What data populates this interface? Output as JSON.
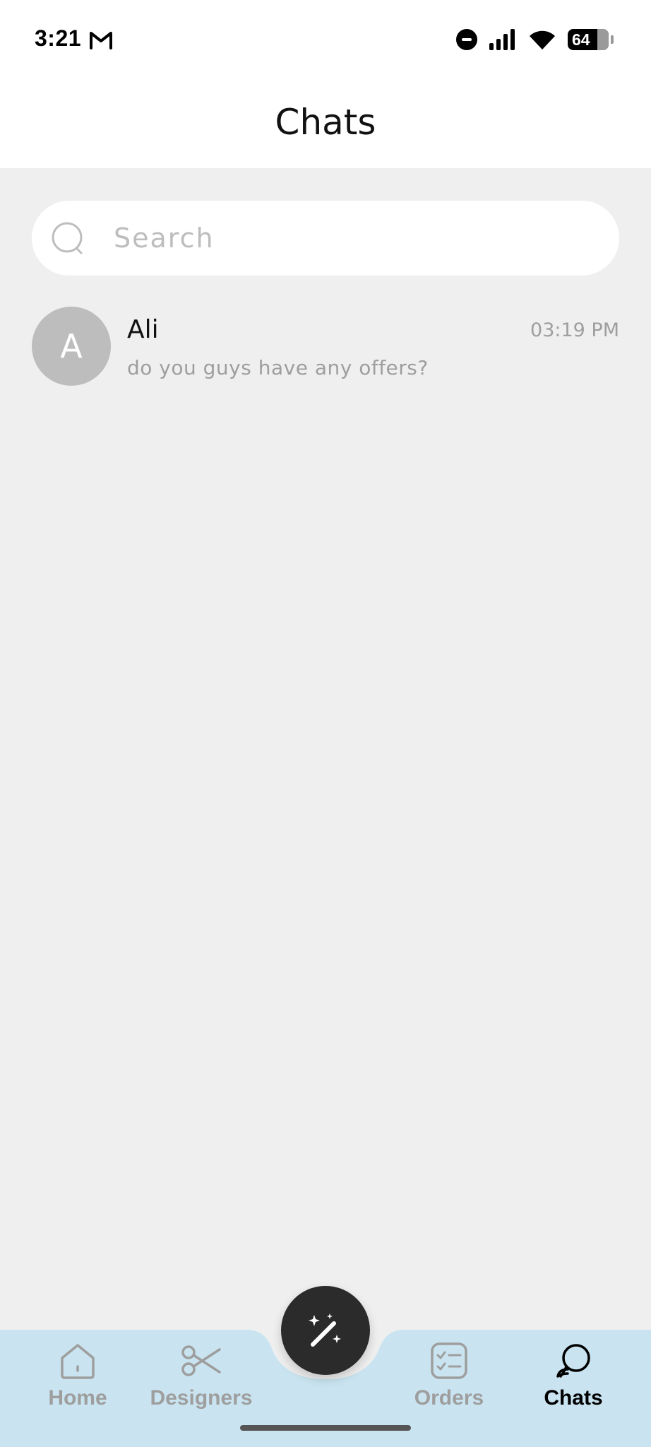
{
  "status_bar": {
    "time": "3:21",
    "battery_level": "64",
    "notification_icon": "gmail-icon",
    "indicators": [
      "do-not-disturb-icon",
      "signal-icon",
      "wifi-icon",
      "battery-icon"
    ]
  },
  "header": {
    "title": "Chats"
  },
  "search": {
    "placeholder": "Search",
    "value": ""
  },
  "chats": [
    {
      "avatar_letter": "A",
      "name": "Ali",
      "time": "03:19 PM",
      "preview": "do you guys have any offers?"
    }
  ],
  "nav": {
    "items": [
      {
        "label": "Home",
        "icon": "home-icon",
        "active": false
      },
      {
        "label": "Designers",
        "icon": "scissors-icon",
        "active": false
      },
      {
        "label": "Orders",
        "icon": "checklist-icon",
        "active": false
      },
      {
        "label": "Chats",
        "icon": "chat-bubbles-icon",
        "active": true
      }
    ],
    "fab_icon": "magic-wand-icon"
  },
  "colors": {
    "background": "#efefef",
    "nav_background": "#c9e4f0",
    "fab": "#2b2b2b",
    "inactive": "#9e9e9e",
    "active": "#000000",
    "avatar": "#bdbdbd"
  }
}
